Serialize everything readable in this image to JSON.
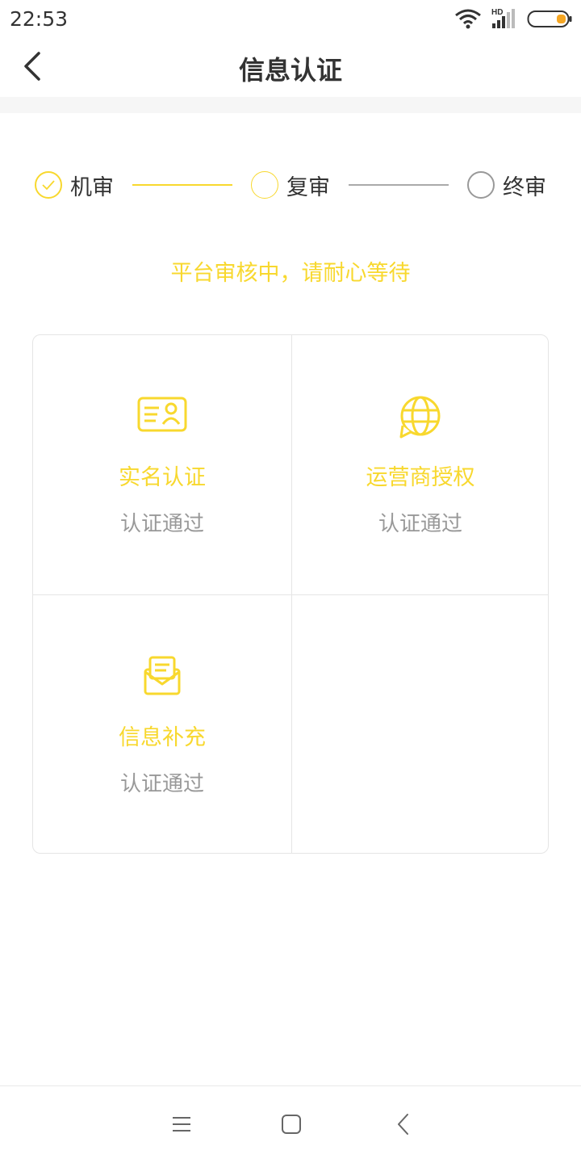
{
  "status_bar": {
    "time": "22:53",
    "network_label": "HD"
  },
  "header": {
    "title": "信息认证"
  },
  "steps": [
    {
      "label": "机审",
      "state": "done"
    },
    {
      "label": "复审",
      "state": "active"
    },
    {
      "label": "终审",
      "state": "pending"
    }
  ],
  "status_message": "平台审核中，请耐心等待",
  "cards": [
    {
      "title": "实名认证",
      "status": "认证通过",
      "icon": "id-card-icon"
    },
    {
      "title": "运营商授权",
      "status": "认证通过",
      "icon": "globe-icon"
    },
    {
      "title": "信息补充",
      "status": "认证通过",
      "icon": "envelope-icon"
    }
  ],
  "colors": {
    "accent": "#f8d82e",
    "muted_text": "#999999",
    "text": "#333333",
    "step_pending": "#cccccc",
    "battery": "#f5a623"
  }
}
